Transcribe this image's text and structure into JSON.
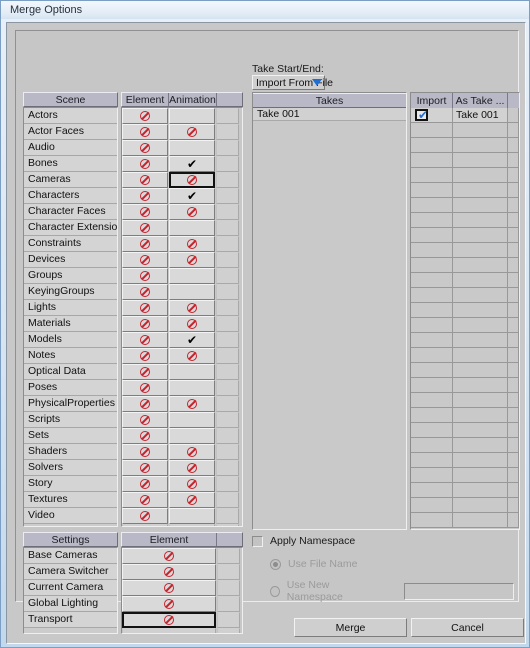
{
  "window": {
    "title": "Merge Options"
  },
  "scene_table": {
    "headers": [
      "Scene",
      "Element",
      "Animation",
      ""
    ],
    "rows": [
      {
        "label": "Actors",
        "element": "block",
        "animation": ""
      },
      {
        "label": "Actor Faces",
        "element": "block",
        "animation": "block"
      },
      {
        "label": "Audio",
        "element": "block",
        "animation": ""
      },
      {
        "label": "Bones",
        "element": "block",
        "animation": "check"
      },
      {
        "label": "Cameras",
        "element": "block",
        "animation": "block",
        "selected": true
      },
      {
        "label": "Characters",
        "element": "block",
        "animation": "check"
      },
      {
        "label": "Character Faces",
        "element": "block",
        "animation": "block"
      },
      {
        "label": "Character Extensions",
        "element": "block",
        "animation": ""
      },
      {
        "label": "Constraints",
        "element": "block",
        "animation": "block"
      },
      {
        "label": "Devices",
        "element": "block",
        "animation": "block"
      },
      {
        "label": "Groups",
        "element": "block",
        "animation": ""
      },
      {
        "label": "KeyingGroups",
        "element": "block",
        "animation": ""
      },
      {
        "label": "Lights",
        "element": "block",
        "animation": "block"
      },
      {
        "label": "Materials",
        "element": "block",
        "animation": "block"
      },
      {
        "label": "Models",
        "element": "block",
        "animation": "check"
      },
      {
        "label": "Notes",
        "element": "block",
        "animation": "block"
      },
      {
        "label": "Optical Data",
        "element": "block",
        "animation": ""
      },
      {
        "label": "Poses",
        "element": "block",
        "animation": ""
      },
      {
        "label": "PhysicalProperties",
        "element": "block",
        "animation": "block"
      },
      {
        "label": "Scripts",
        "element": "block",
        "animation": ""
      },
      {
        "label": "Sets",
        "element": "block",
        "animation": ""
      },
      {
        "label": "Shaders",
        "element": "block",
        "animation": "block"
      },
      {
        "label": "Solvers",
        "element": "block",
        "animation": "block"
      },
      {
        "label": "Story",
        "element": "block",
        "animation": "block"
      },
      {
        "label": "Textures",
        "element": "block",
        "animation": "block"
      },
      {
        "label": "Video",
        "element": "block",
        "animation": ""
      }
    ]
  },
  "settings_table": {
    "headers": [
      "Settings",
      "Element",
      ""
    ],
    "rows": [
      {
        "label": "Base Cameras",
        "element": "block"
      },
      {
        "label": "Camera Switcher",
        "element": "block"
      },
      {
        "label": "Current Camera",
        "element": "block"
      },
      {
        "label": "Global Lighting",
        "element": "block"
      },
      {
        "label": "Transport",
        "element": "block",
        "selected": true
      }
    ]
  },
  "take_section": {
    "label": "Take Start/End:",
    "combo_value": "Import From File",
    "takes_header": "Takes",
    "takes": [
      "Take 001"
    ],
    "import_headers": [
      "Import",
      "As Take ...",
      ""
    ],
    "import_rows": [
      {
        "checked": true,
        "as_take": "Take 001"
      }
    ]
  },
  "namespace": {
    "apply_label": "Apply Namespace",
    "apply_checked": false,
    "use_file_name_label": "Use File Name",
    "use_file_name_selected": true,
    "use_new_namespace_label": "Use New Namespace",
    "use_new_namespace_selected": false,
    "new_namespace_value": ""
  },
  "buttons": {
    "merge": "Merge",
    "cancel": "Cancel"
  },
  "colors": {
    "block_icon": "#c4242e",
    "check_icon": "#000000",
    "checkbox_tick": "#2a6fcf",
    "header_bg": "#b8b8c6",
    "panel_bg": "#c6c6c6",
    "titlebar_text": "#24313d"
  }
}
